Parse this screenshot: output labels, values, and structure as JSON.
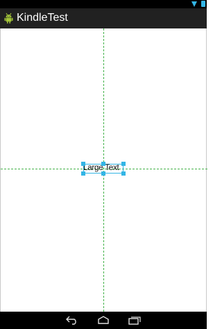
{
  "app": {
    "title": "KindleTest",
    "icon": "android-icon"
  },
  "status_bar": {
    "icons": [
      "wifi-icon",
      "battery-icon"
    ]
  },
  "canvas": {
    "widget_text": "Large Text",
    "guide_color": "#44b24a",
    "selection_color": "#33b5e5"
  },
  "nav_bar": {
    "buttons": [
      "back-icon",
      "home-icon",
      "recent-apps-icon"
    ]
  }
}
